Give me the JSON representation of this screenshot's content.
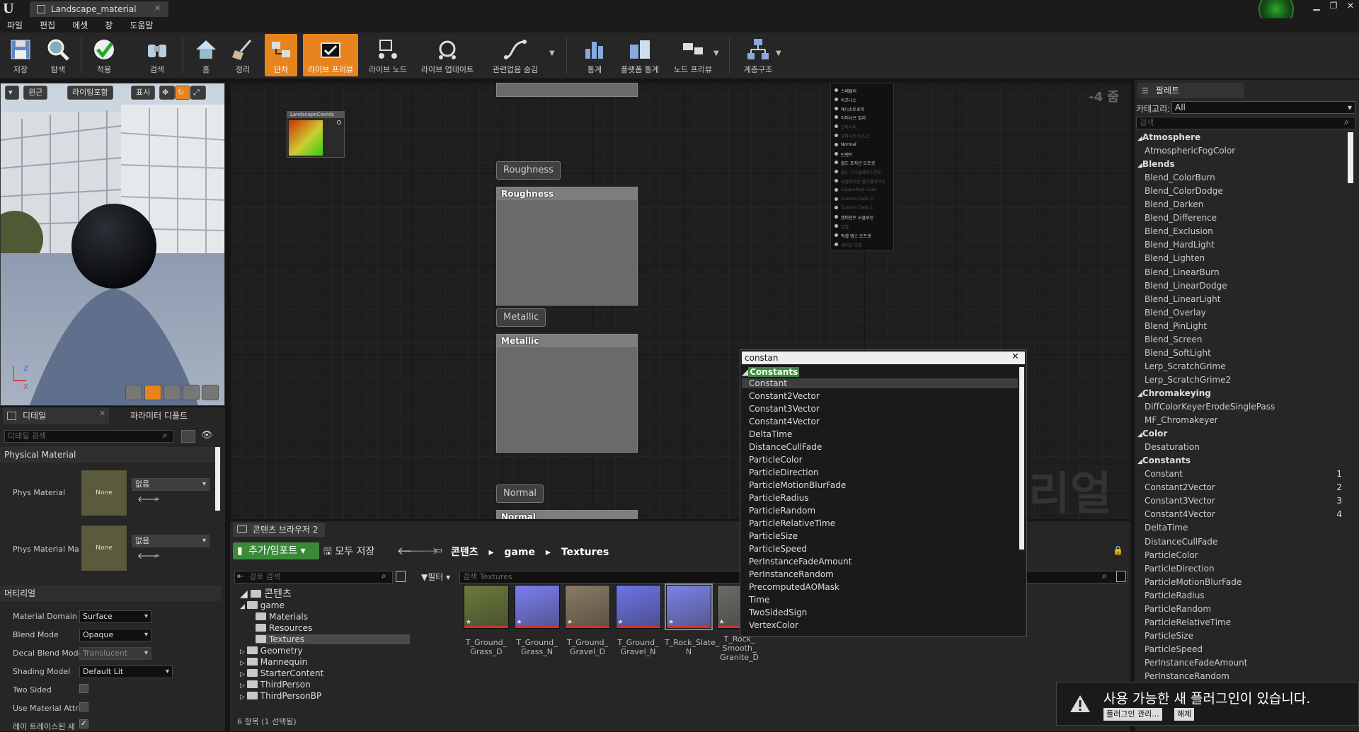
{
  "app": {
    "tab_title": "Landscape_material"
  },
  "menu": [
    "파일",
    "편집",
    "에셋",
    "창",
    "도움말"
  ],
  "toolbar": {
    "items": [
      "저장",
      "탐색",
      "적용",
      "검색",
      "홈",
      "정리",
      "단차",
      "라이브 프리뷰",
      "라이브 노드",
      "라이브 업데이트",
      "관련없음 숨김",
      "통계",
      "플랫폼 통계",
      "노드 프리뷰",
      "계층구조"
    ],
    "active": [
      "단차",
      "라이브 프리뷰"
    ],
    "accent_color": "#e8841e"
  },
  "viewport": {
    "buttons": [
      "원근",
      "라이팅포함",
      "표시"
    ]
  },
  "details": {
    "tabs": [
      "디테일",
      "파라미터 디폴트"
    ],
    "search_placeholder": "디테일 검색",
    "section_physical": "Physical Material",
    "phys_material_label": "Phys Material",
    "phys_material_map_label": "Phys Material Ma",
    "none_text": "None",
    "none_select": "없음",
    "section_material": "머티리얼",
    "props": [
      {
        "label": "Material Domain",
        "value": "Surface"
      },
      {
        "label": "Blend Mode",
        "value": "Opaque"
      },
      {
        "label": "Decal Blend Mode",
        "value": "Translucent"
      },
      {
        "label": "Shading Model",
        "value": "Default Lit"
      },
      {
        "label": "Two Sided",
        "value": ""
      },
      {
        "label": "Use Material Attri",
        "value": ""
      },
      {
        "label": "레이 트레이스된 새",
        "value": ""
      }
    ]
  },
  "graph": {
    "node_landscape": "LandscapeCoords",
    "zoom": "-4 줌",
    "pins": [
      "Roughness",
      "Metallic",
      "Normal"
    ],
    "watermark": "리얼",
    "result_node_rows": [
      "스페큘러",
      "러프니스",
      "애니소트로피",
      "이미시브 컬러",
      "오파시티",
      "오파시티 마스크",
      "Normal",
      "탄젠트",
      "월드 포지션 오프셋",
      "월드 디스플레이스먼트",
      "테셀레이션 멀티플라이어",
      "Subsurface Color",
      "Custom Data 0",
      "Custom Data 1",
      "앰비언트 오클루전",
      "굴절",
      "픽셀 뎁스 오프셋",
      "셰이딩 모델"
    ]
  },
  "search_popup": {
    "query": "constan",
    "category": "Constants",
    "items": [
      "Constant",
      "Constant2Vector",
      "Constant3Vector",
      "Constant4Vector",
      "DeltaTime",
      "DistanceCullFade",
      "ParticleColor",
      "ParticleDirection",
      "ParticleMotionBlurFade",
      "ParticleRadius",
      "ParticleRandom",
      "ParticleRelativeTime",
      "ParticleSize",
      "ParticleSpeed",
      "PerInstanceFadeAmount",
      "PerInstanceRandom",
      "PrecomputedAOMask",
      "Time",
      "TwoSidedSign",
      "VertexColor"
    ],
    "selected": "Constant"
  },
  "content_browser": {
    "tab": "콘텐츠 브라우저 2",
    "add_import": "추가/임포트",
    "save_all": "모두 저장",
    "breadcrumb": [
      "콘텐츠",
      "game",
      "Textures"
    ],
    "path_search_placeholder": "경로 검색",
    "filter_label": "필터",
    "search_placeholder": "검색 Textures",
    "tree_root": "콘텐츠",
    "tree": [
      {
        "name": "game",
        "level": 1
      },
      {
        "name": "Materials",
        "level": 2
      },
      {
        "name": "Resources",
        "level": 2
      },
      {
        "name": "Textures",
        "level": 2,
        "selected": true
      },
      {
        "name": "Geometry",
        "level": 1
      },
      {
        "name": "Mannequin",
        "level": 1
      },
      {
        "name": "StarterContent",
        "level": 1
      },
      {
        "name": "ThirdPerson",
        "level": 1
      },
      {
        "name": "ThirdPersonBP",
        "level": 1
      }
    ],
    "assets": [
      {
        "name": "T_Ground_\nGrass_D",
        "color": "#6b7a3a"
      },
      {
        "name": "T_Ground_\nGrass_N",
        "color": "#7b7ef0"
      },
      {
        "name": "T_Ground_\nGravel_D",
        "color": "#8a7a64"
      },
      {
        "name": "T_Ground_\nGravel_N",
        "color": "#6e74e6"
      },
      {
        "name": "T_Rock_Slate_\nN",
        "color": "#7d82e8"
      },
      {
        "name": "T_Rock_\nSmooth_\nGranite_D",
        "color": "#6a6a66"
      }
    ],
    "status": "6 항목 (1 선택됨)"
  },
  "palette": {
    "title": "팔레트",
    "category_label": "카테고리:",
    "category_value": "All",
    "search_placeholder": "검색",
    "entries": [
      {
        "t": "c",
        "text": "Atmosphere"
      },
      {
        "t": "i",
        "text": "AtmosphericFogColor"
      },
      {
        "t": "c",
        "text": "Blends"
      },
      {
        "t": "i",
        "text": "Blend_ColorBurn"
      },
      {
        "t": "i",
        "text": "Blend_ColorDodge"
      },
      {
        "t": "i",
        "text": "Blend_Darken"
      },
      {
        "t": "i",
        "text": "Blend_Difference"
      },
      {
        "t": "i",
        "text": "Blend_Exclusion"
      },
      {
        "t": "i",
        "text": "Blend_HardLight"
      },
      {
        "t": "i",
        "text": "Blend_Lighten"
      },
      {
        "t": "i",
        "text": "Blend_LinearBurn"
      },
      {
        "t": "i",
        "text": "Blend_LinearDodge"
      },
      {
        "t": "i",
        "text": "Blend_LinearLight"
      },
      {
        "t": "i",
        "text": "Blend_Overlay"
      },
      {
        "t": "i",
        "text": "Blend_PinLight"
      },
      {
        "t": "i",
        "text": "Blend_Screen"
      },
      {
        "t": "i",
        "text": "Blend_SoftLight"
      },
      {
        "t": "i",
        "text": "Lerp_ScratchGrime"
      },
      {
        "t": "i",
        "text": "Lerp_ScratchGrime2"
      },
      {
        "t": "c",
        "text": "Chromakeying"
      },
      {
        "t": "i",
        "text": "DiffColorKeyerErodeSinglePass"
      },
      {
        "t": "i",
        "text": "MF_Chromakeyer"
      },
      {
        "t": "c",
        "text": "Color"
      },
      {
        "t": "i",
        "text": "Desaturation"
      },
      {
        "t": "c",
        "text": "Constants"
      },
      {
        "t": "i",
        "text": "Constant",
        "n": "1"
      },
      {
        "t": "i",
        "text": "Constant2Vector",
        "n": "2"
      },
      {
        "t": "i",
        "text": "Constant3Vector",
        "n": "3"
      },
      {
        "t": "i",
        "text": "Constant4Vector",
        "n": "4"
      },
      {
        "t": "i",
        "text": "DeltaTime"
      },
      {
        "t": "i",
        "text": "DistanceCullFade"
      },
      {
        "t": "i",
        "text": "ParticleColor"
      },
      {
        "t": "i",
        "text": "ParticleDirection"
      },
      {
        "t": "i",
        "text": "ParticleMotionBlurFade"
      },
      {
        "t": "i",
        "text": "ParticleRadius"
      },
      {
        "t": "i",
        "text": "ParticleRandom"
      },
      {
        "t": "i",
        "text": "ParticleRelativeTime"
      },
      {
        "t": "i",
        "text": "ParticleSize"
      },
      {
        "t": "i",
        "text": "ParticleSpeed"
      },
      {
        "t": "i",
        "text": "PerInstanceFadeAmount"
      },
      {
        "t": "i",
        "text": "PerInstanceRandom"
      }
    ]
  },
  "notification": {
    "message": "사용 가능한 새 플러그인이 있습니다.",
    "manage_button": "플러그인 관리...",
    "dismiss_button": "해제"
  }
}
